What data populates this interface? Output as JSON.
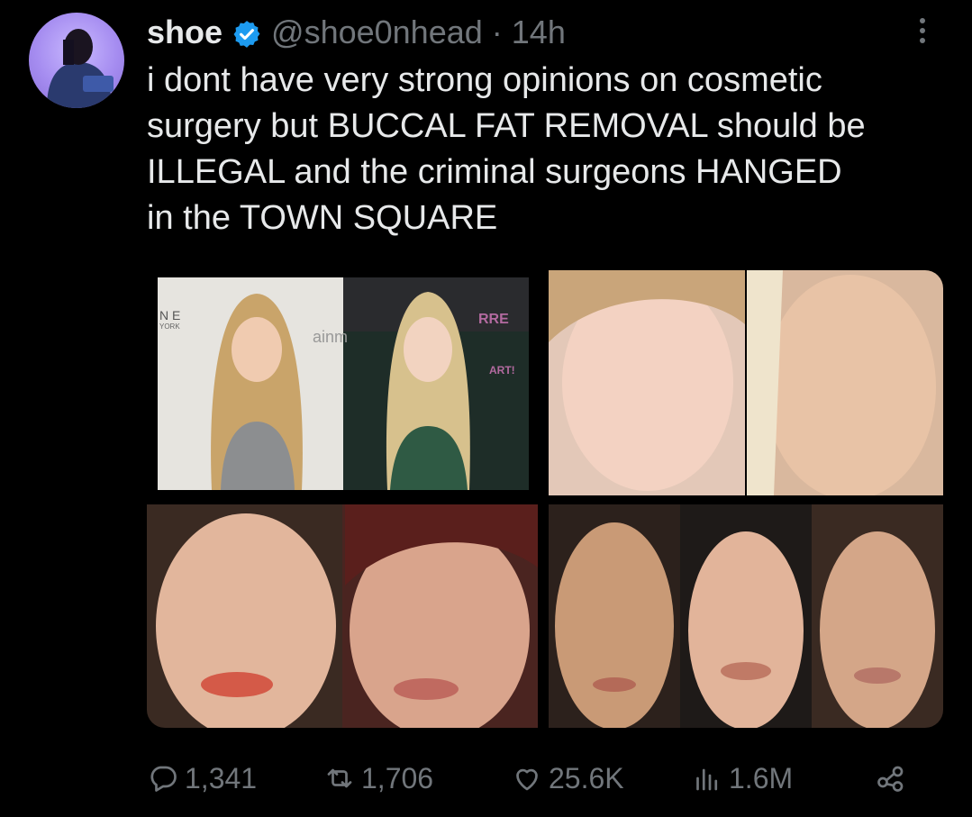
{
  "tweet": {
    "display_name": "shoe",
    "handle": "@shoe0nhead",
    "separator": "·",
    "time": "14h",
    "text": "i dont have very strong opinions on cosmetic\nsurgery but BUCCAL FAT REMOVAL should be\nILLEGAL and the criminal surgeons HANGED\nin the TOWN SQUARE"
  },
  "media": {
    "photo_signs": [
      "N E",
      "YORK",
      "ainm",
      "RRE",
      "ART!"
    ]
  },
  "actions": {
    "replies": "1,341",
    "reposts": "1,706",
    "likes": "25.6K",
    "views": "1.6M"
  },
  "colors": {
    "background": "#000000",
    "text": "#e7e9ea",
    "muted": "#71767b",
    "verified": "#1d9bf0"
  },
  "icons": [
    "verified-badge-icon",
    "more-vert-icon",
    "reply-icon",
    "repost-icon",
    "like-icon",
    "views-icon",
    "share-icon"
  ]
}
